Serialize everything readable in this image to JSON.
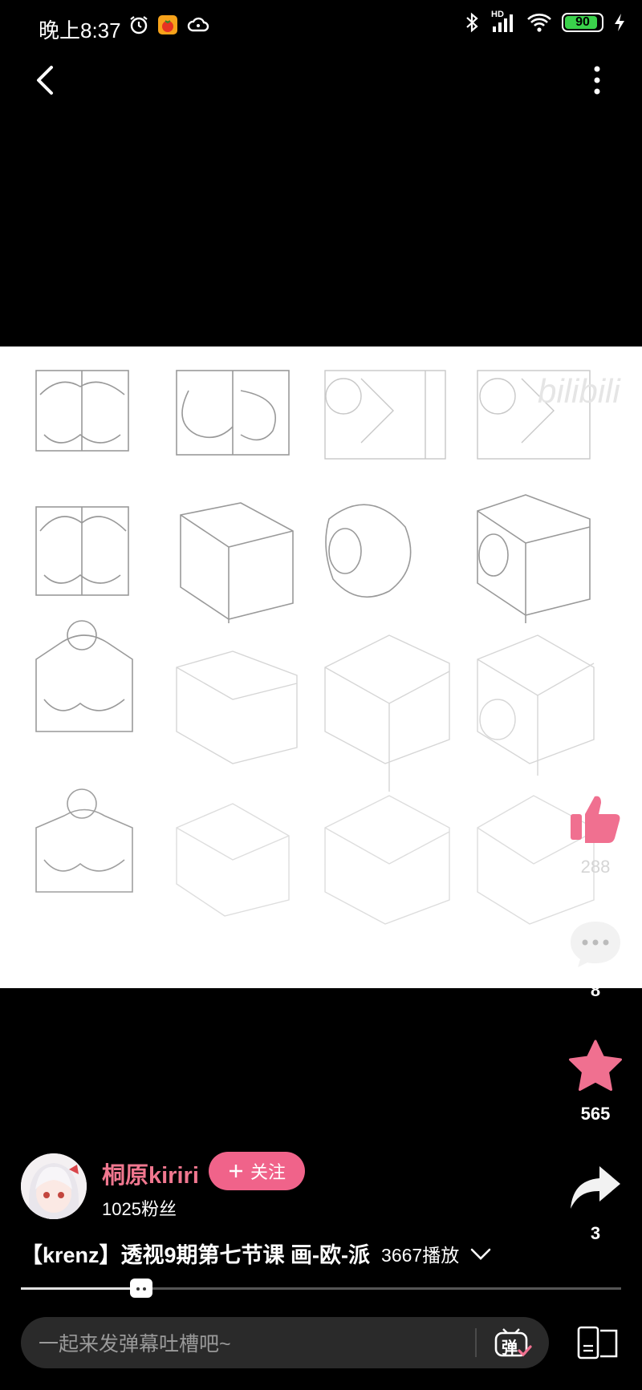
{
  "status_bar": {
    "time": "晚上8:37",
    "network": "HD",
    "battery_level": "90",
    "battery_percent": 90,
    "icons": [
      "alarm-icon",
      "tomato-app-icon",
      "cloud-icon",
      "bluetooth-icon",
      "signal-icon",
      "wifi-icon",
      "battery-icon",
      "charging-icon"
    ]
  },
  "nav": {
    "back_icon": "chevron-left-icon",
    "more_icon": "more-vertical-icon"
  },
  "video": {
    "watermark": "bilibili"
  },
  "actions": {
    "like_count": "288",
    "comment_count": "8",
    "favorite_count": "565",
    "share_count": "3"
  },
  "author": {
    "name": "桐原kiriri",
    "follow_label": "关注",
    "fans": "1025粉丝"
  },
  "title": {
    "text": "【krenz】透视9期第七节课 画-欧-派",
    "play_count": "3667播放"
  },
  "progress": {
    "played_fraction": 0.2
  },
  "bottom": {
    "danmaku_placeholder": "一起来发弹幕吐槽吧~",
    "danmaku_label": "弹"
  },
  "colors": {
    "accent": "#f0638a",
    "author_name": "#f0778f",
    "battery": "#3ad24b"
  }
}
